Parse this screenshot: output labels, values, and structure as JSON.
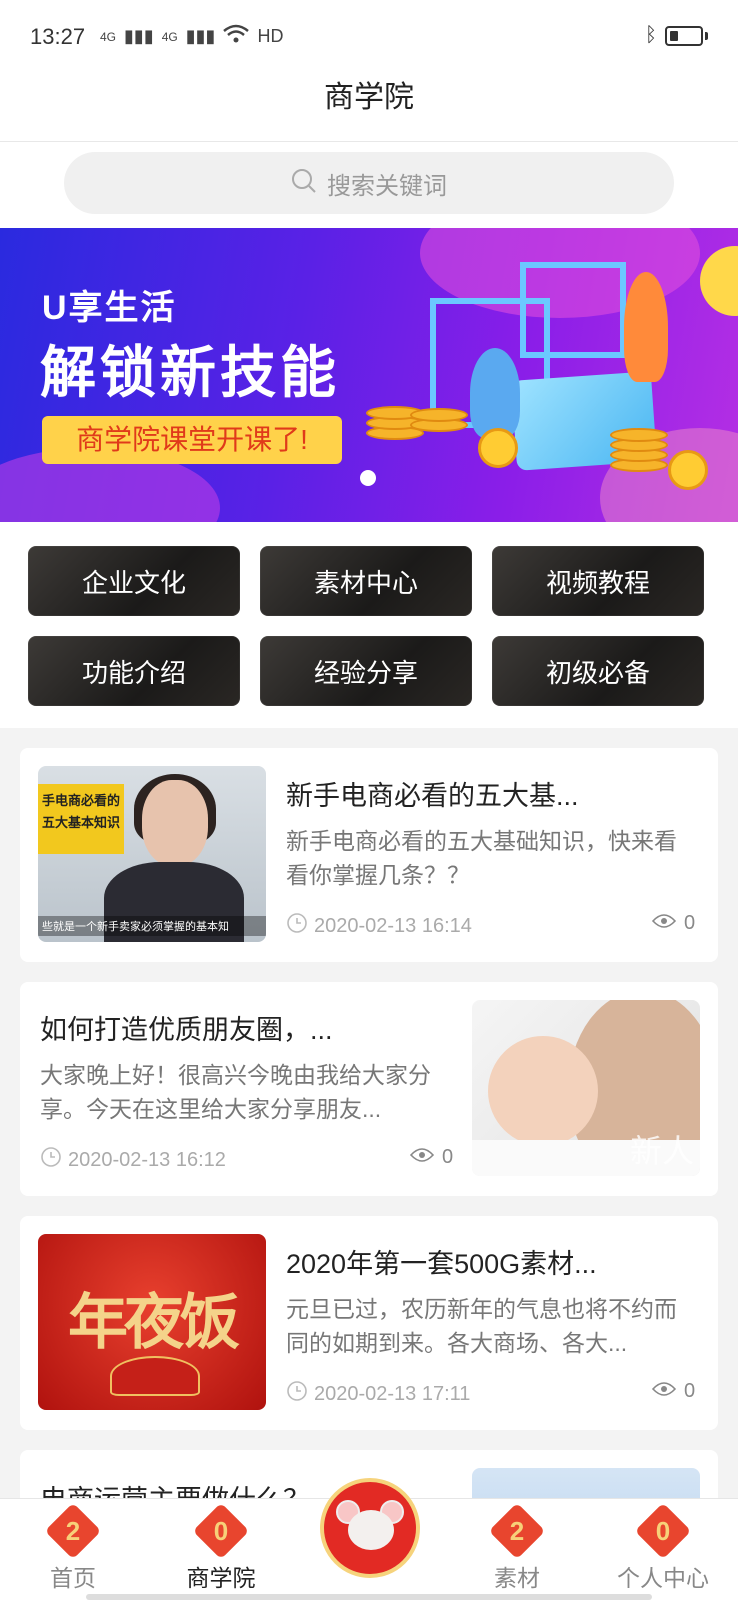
{
  "status": {
    "time": "13:27",
    "signal1": "4G",
    "signal2": "4G",
    "network": "HD"
  },
  "header": {
    "title": "商学院"
  },
  "search": {
    "placeholder": "搜索关键词"
  },
  "banner": {
    "small_text": "U享生活",
    "big_text": "解锁新技能",
    "tag_text": "商学院课堂开课了!"
  },
  "categories": [
    {
      "label": "企业文化"
    },
    {
      "label": "素材中心"
    },
    {
      "label": "视频教程"
    },
    {
      "label": "功能介绍"
    },
    {
      "label": "经验分享"
    },
    {
      "label": "初级必备"
    }
  ],
  "articles": [
    {
      "title": "新手电商必看的五大基...",
      "desc": "新手电商必看的五大基础知识，快来看看你掌握几条？？",
      "date": "2020-02-13 16:14",
      "views": "0",
      "thumb_strip": "手电商必看的 五大基本知识",
      "thumb_caption": "些就是一个新手卖家必须掌握的基本知"
    },
    {
      "title": "如何打造优质朋友圈，...",
      "desc": "大家晚上好！很高兴今晚由我给大家分享。今天在这里给大家分享朋友...",
      "date": "2020-02-13 16:12",
      "views": "0",
      "thumb_text": "新人"
    },
    {
      "title": "2020年第一套500G素材...",
      "desc": "元旦已过，农历新年的气息也将不约而同的如期到来。各大商场、各大...",
      "date": "2020-02-13 17:11",
      "views": "0",
      "thumb_text": "年夜饭"
    },
    {
      "title": "电商运营主要做什么？"
    }
  ],
  "tabbar": {
    "items": [
      {
        "label": "首页",
        "icon_char": "2"
      },
      {
        "label": "商学院",
        "icon_char": "0"
      },
      {
        "label": "素材",
        "icon_char": "2"
      },
      {
        "label": "个人中心",
        "icon_char": "0"
      }
    ],
    "active": "商学院"
  },
  "colors": {
    "accent": "#e8452e",
    "banner_start": "#2a2adf",
    "banner_end": "#b52fe4",
    "tag_bg": "#ffd24a"
  }
}
